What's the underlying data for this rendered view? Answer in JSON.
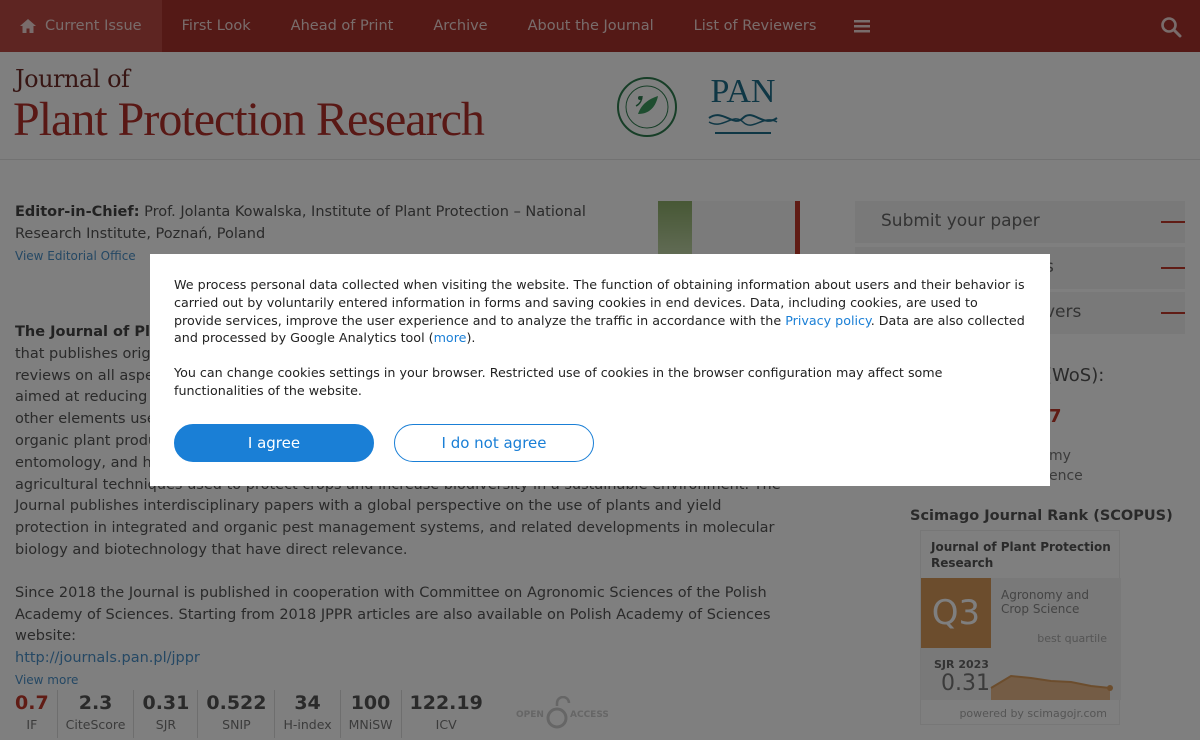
{
  "nav": {
    "items": [
      {
        "label": "Current Issue"
      },
      {
        "label": "First Look"
      },
      {
        "label": "Ahead of Print"
      },
      {
        "label": "Archive"
      },
      {
        "label": "About the Journal"
      },
      {
        "label": "List of Reviewers"
      }
    ],
    "accent": "#a8322d"
  },
  "header": {
    "logo_line1": "Journal of",
    "logo_line2": "Plant Protection Research",
    "pan_logo": "PAN"
  },
  "editor": {
    "label": "Editor-in-Chief:",
    "text": "Prof. Jolanta Kowalska, Institute of Plant Protection – National Research Institute, Poznań, Poland",
    "link": "View Editorial Office"
  },
  "about": {
    "title": "The Journal of Plant",
    "lines": [
      "that publishes origin",
      "reviews on all aspect",
      "aimed at reducing pe",
      "other elements usefu",
      "organic plant produc",
      "entomology, and her"
    ],
    "line_partial": "agricultural techniques used to protect crops and increase biodiversity in a sustainable environment. The Journal",
    "paragraph_end": "publishes interdisciplinary papers with a global perspective on the use of plants and yield protection in integrated and organic pest management systems, and related developments in molecular biology and biotechnology that have direct relevance.",
    "paragraph2": "Since 2018 the Journal is published in cooperation with Committee on Agronomic Sciences of the Polish Academy of Sciences. Starting from 2018 JPPR articles are also available on Polish Academy of Sciences website:",
    "url": "http://journals.pan.pl/jppr",
    "view_more": "View more"
  },
  "metrics": [
    {
      "value": "0.7",
      "label": "IF"
    },
    {
      "value": "2.3",
      "label": "CiteScore"
    },
    {
      "value": "0.31",
      "label": "SJR"
    },
    {
      "value": "0.522",
      "label": "SNIP"
    },
    {
      "value": "34",
      "label": "H-index"
    },
    {
      "value": "100",
      "label": "MNiSW"
    },
    {
      "value": "122.19",
      "label": "ICV"
    }
  ],
  "open_access": {
    "left": "OPEN",
    "right": "ACCESS"
  },
  "sidebar": {
    "submit": "Submit your paper",
    "btn2_tail": "s",
    "btn3_tail": "vers",
    "wos_tail": "(WoS):",
    "wos_value_tail": "7",
    "category_tail1": "my",
    "category_tail2": "ence"
  },
  "scimago": {
    "title": "Scimago Journal Rank (SCOPUS)",
    "journal": "Journal of Plant Protection Research",
    "quartile": "Q3",
    "category": "Agronomy and Crop Science",
    "best": "best quartile",
    "sjr_label": "SJR 2023",
    "sjr_value": "0.31",
    "powered": "powered by scimagojr.com"
  },
  "cookie": {
    "text1_a": "We process personal data collected when visiting the website. The function of obtaining information about users and their behavior is carried out by voluntarily entered information in forms and saving cookies in end devices. Data, including cookies, are used to provide services, improve the user experience and to analyze the traffic in accordance with the",
    "privacy_link": "Privacy policy",
    "text1_b": ". Data are also collected and processed by Google Analytics tool (",
    "more_link": "more",
    "text1_c": ").",
    "text2": "You can change cookies settings in your browser. Restricted use of cookies in the browser configuration may affect some functionalities of the website.",
    "agree": "I agree",
    "disagree": "I do not agree"
  }
}
